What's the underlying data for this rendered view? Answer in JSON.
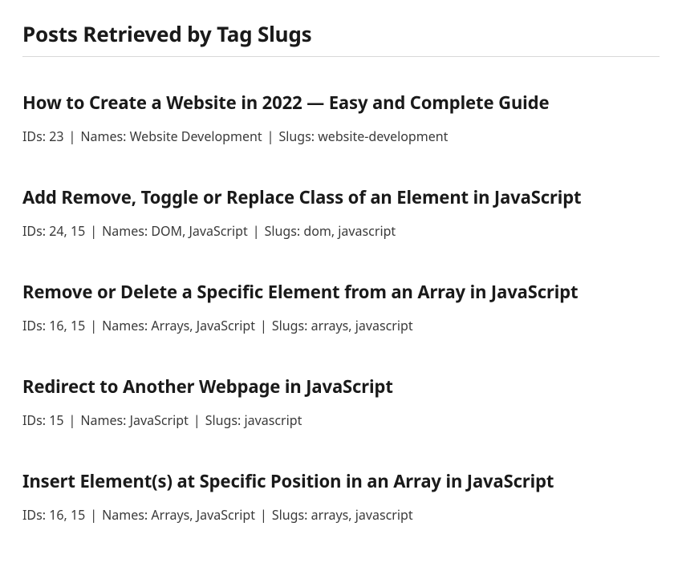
{
  "title": "Posts Retrieved by Tag Slugs",
  "labels": {
    "ids": "IDs:",
    "names": "Names:",
    "slugs": "Slugs:"
  },
  "separator": "|",
  "posts": [
    {
      "title": "How to Create a Website in 2022 — Easy and Complete Guide",
      "ids": "23",
      "names": "Website Development",
      "slugs": "website-development"
    },
    {
      "title": "Add Remove, Toggle or Replace Class of an Element in JavaScript",
      "ids": "24, 15",
      "names": "DOM, JavaScript",
      "slugs": "dom, javascript"
    },
    {
      "title": "Remove or Delete a Specific Element from an Array in JavaScript",
      "ids": "16, 15",
      "names": "Arrays, JavaScript",
      "slugs": "arrays, javascript"
    },
    {
      "title": "Redirect to Another Webpage in JavaScript",
      "ids": "15",
      "names": "JavaScript",
      "slugs": "javascript"
    },
    {
      "title": "Insert Element(s) at Specific Position in an Array in JavaScript",
      "ids": "16, 15",
      "names": "Arrays, JavaScript",
      "slugs": "arrays, javascript"
    }
  ]
}
